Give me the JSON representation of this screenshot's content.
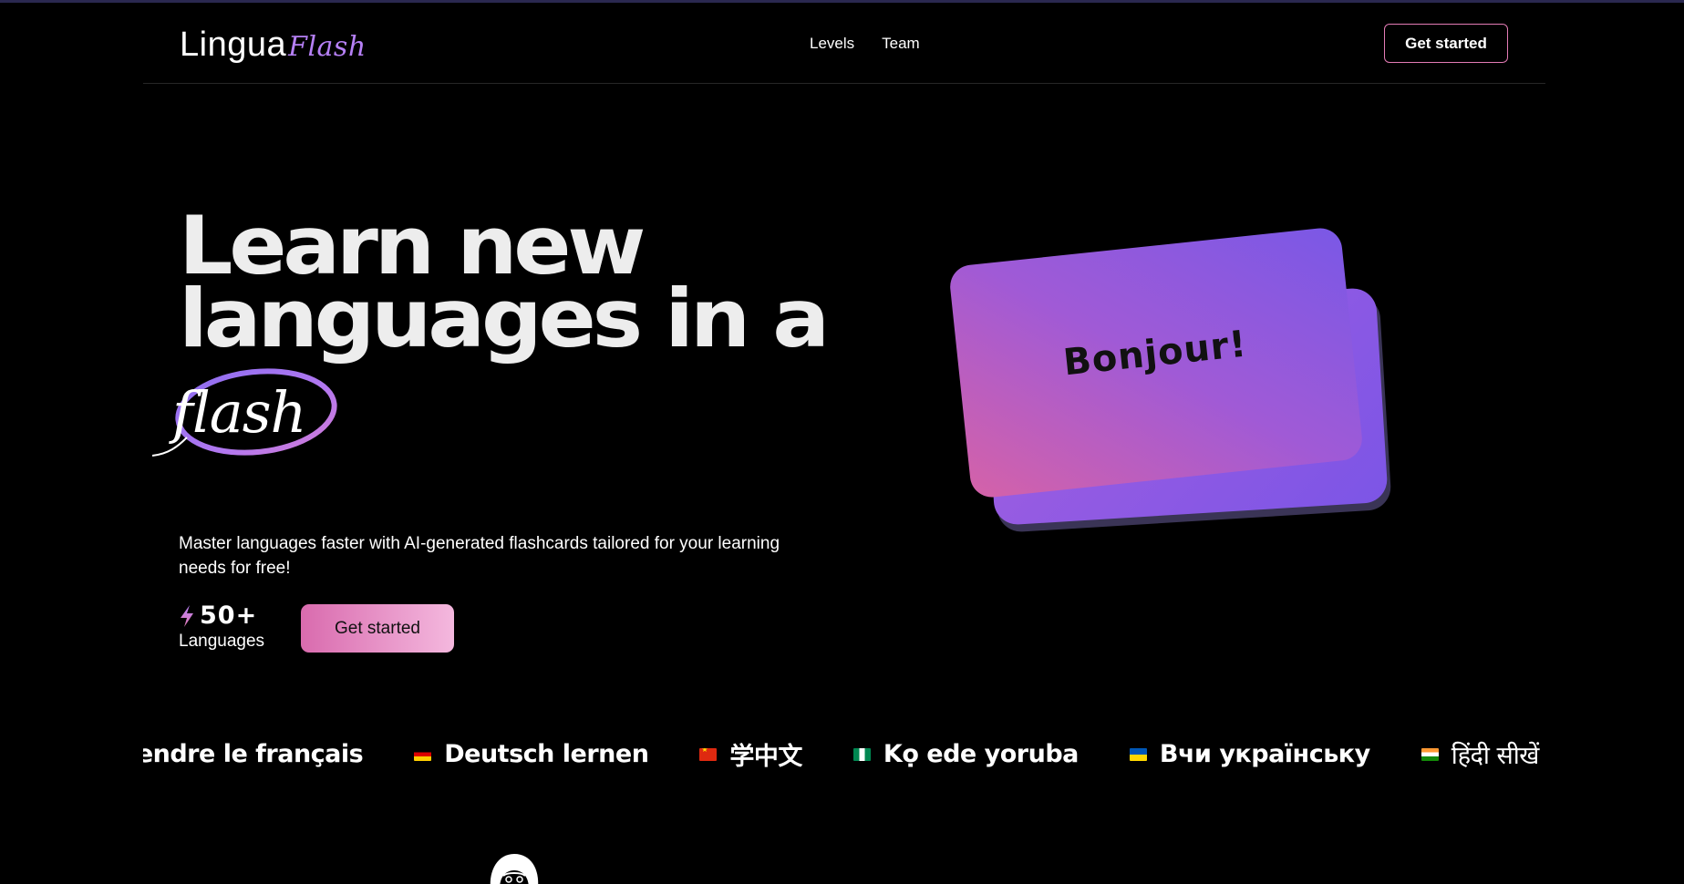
{
  "nav": {
    "logo_main": "Lingua",
    "logo_accent": "Flash",
    "links": [
      "Levels",
      "Team"
    ],
    "cta_label": "Get started"
  },
  "hero": {
    "headline_line1": "Learn new",
    "headline_line2": "languages in a",
    "headline_flash": "flash",
    "subtitle": "Master languages faster with AI-generated flashcards tailored for your learning needs for free!",
    "stat_value": "50+",
    "stat_label": "Languages",
    "cta_label": "Get started"
  },
  "card": {
    "front_text": "Bonjour!"
  },
  "marquee": {
    "items": [
      {
        "flag": "fr",
        "text": "rendre le français"
      },
      {
        "flag": "de",
        "text": "Deutsch lernen"
      },
      {
        "flag": "cn",
        "text": "学中文"
      },
      {
        "flag": "ng",
        "text": "Kọ ede yoruba"
      },
      {
        "flag": "ua",
        "text": "Вчи українську"
      },
      {
        "flag": "in",
        "text": "हिंदी सीखें"
      }
    ]
  },
  "colors": {
    "background": "#000000",
    "accent_purple": "#b680f6",
    "accent_pink": "#e37bb5",
    "card_gradient_start": "#d562a8",
    "card_gradient_end": "#7a58e6"
  }
}
